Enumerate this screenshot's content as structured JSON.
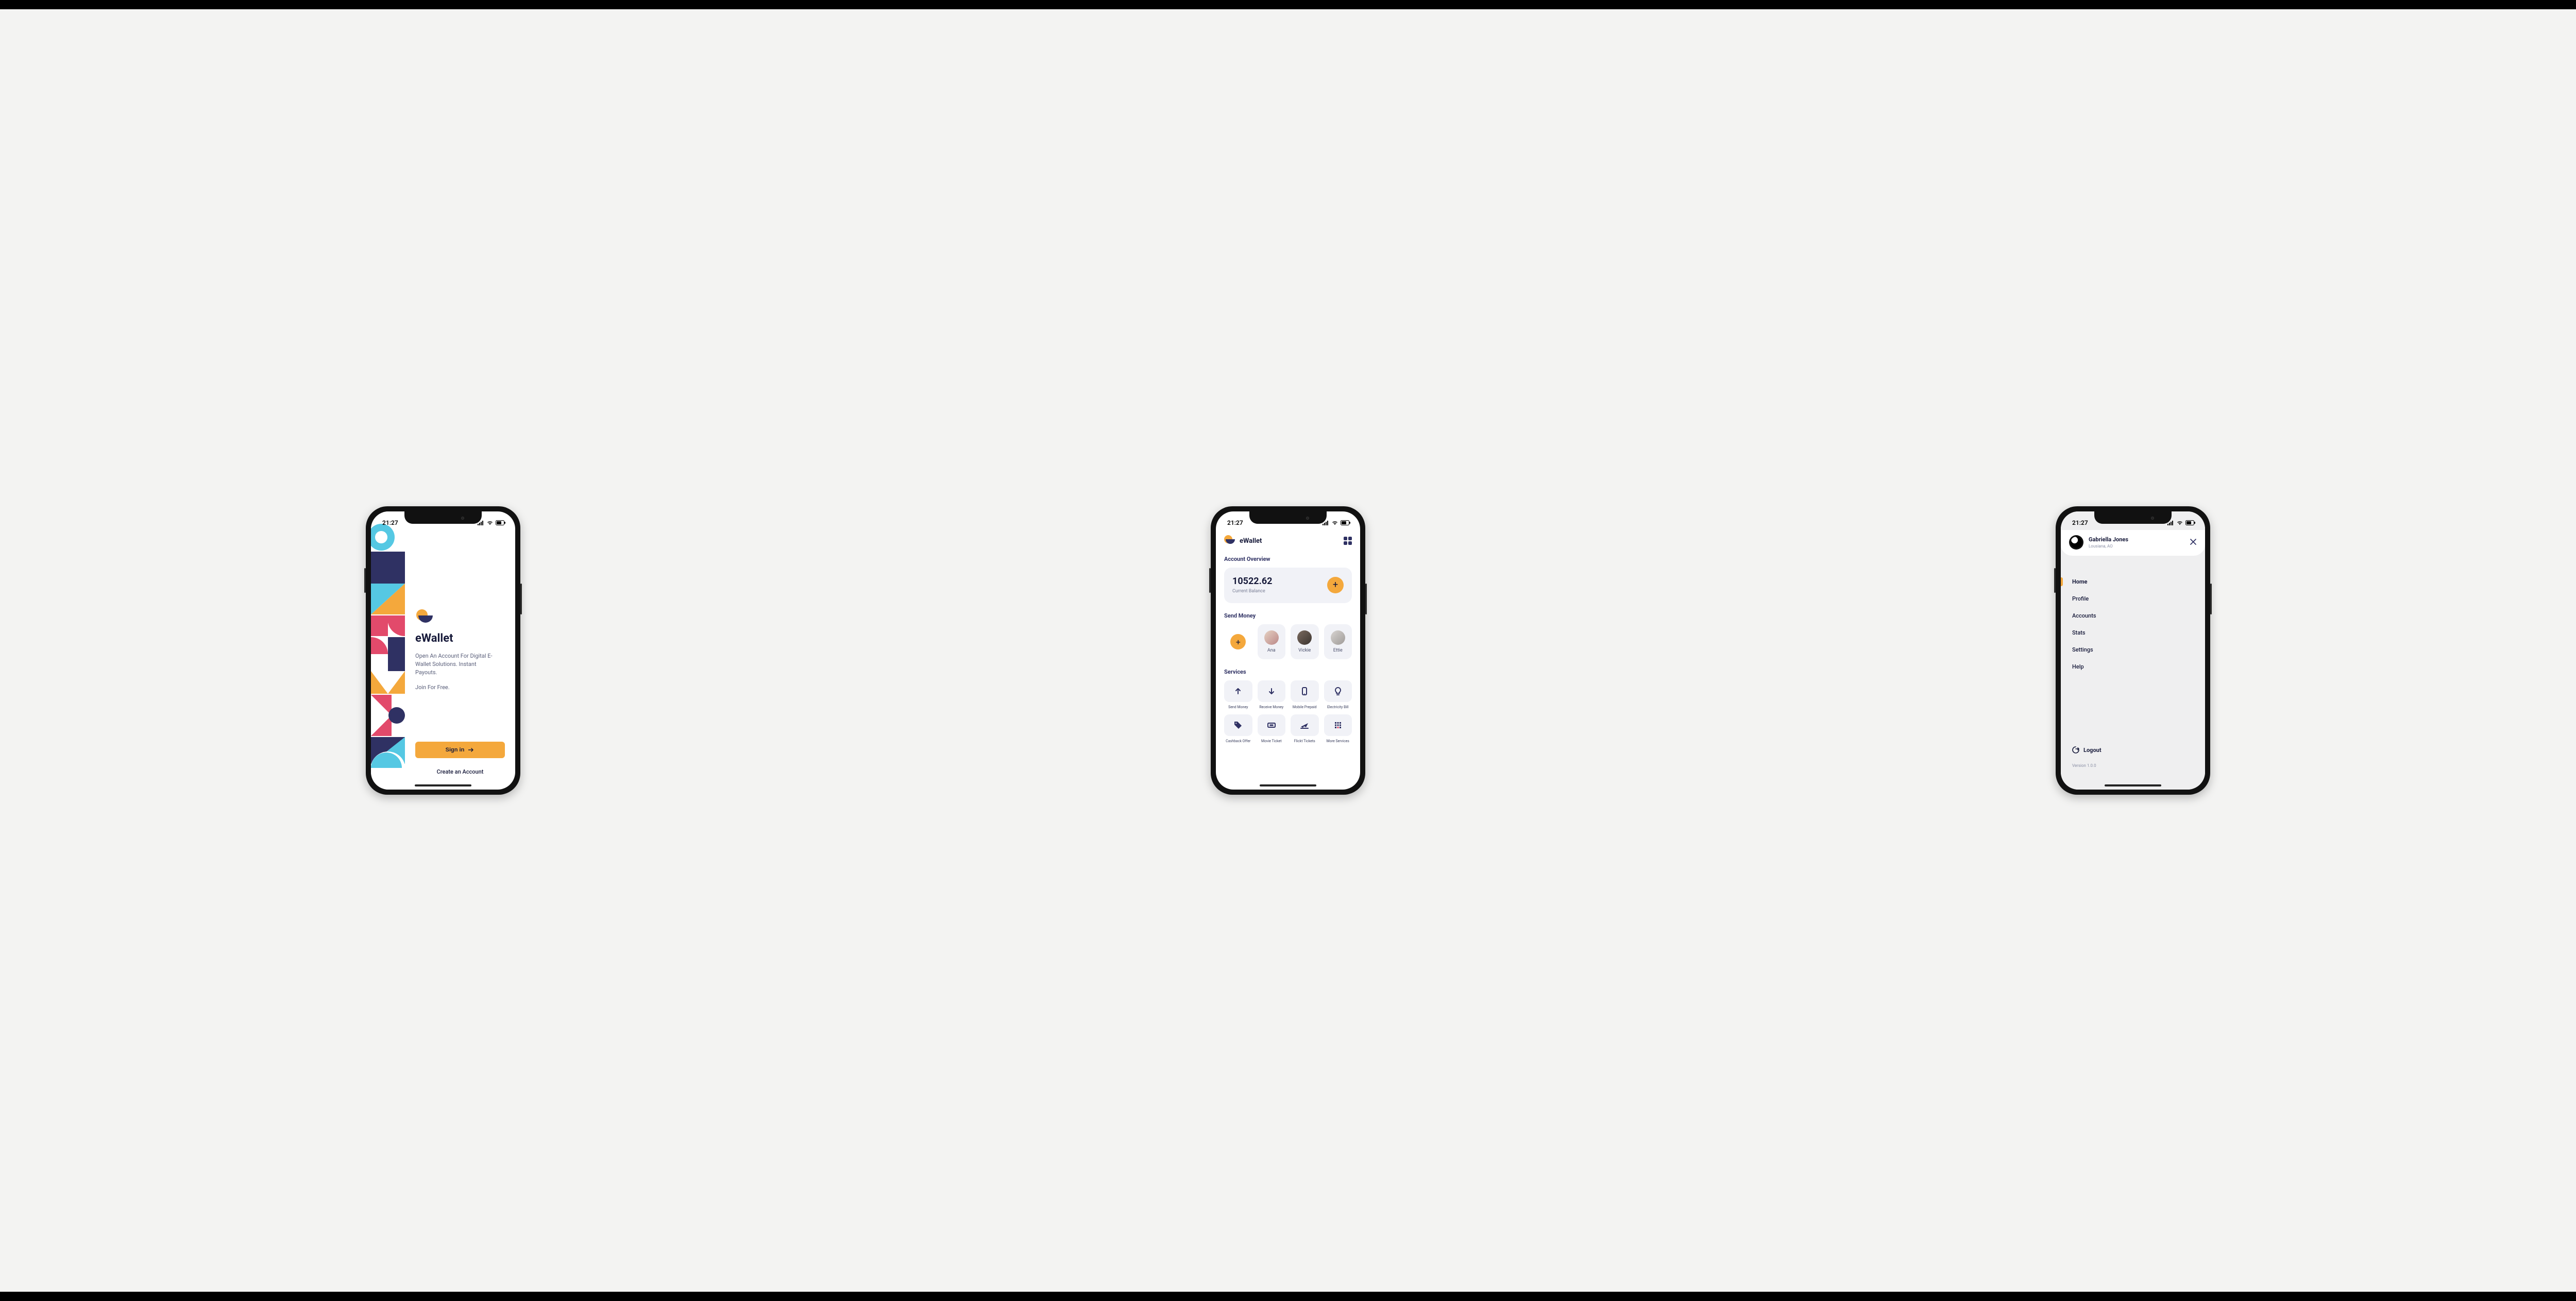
{
  "status": {
    "time": "21:27"
  },
  "s1": {
    "title": "eWallet",
    "desc": "Open An Account For Digital E-Wallet Solutions. Instant Payouts.",
    "join": "Join For Free.",
    "signin": "Sign in",
    "create": "Create an Account"
  },
  "s2": {
    "brand": "eWallet",
    "overview_title": "Account Overview",
    "balance": "10522.62",
    "balance_label": "Current Balance",
    "send_title": "Send Money",
    "contacts": [
      {
        "name": "Ana"
      },
      {
        "name": "Vickie"
      },
      {
        "name": "Ettie"
      }
    ],
    "services_title": "Services",
    "services": [
      {
        "label": "Send Money",
        "icon": "arrow-up"
      },
      {
        "label": "Receive Money",
        "icon": "arrow-down"
      },
      {
        "label": "Mobile Prepaid",
        "icon": "phone"
      },
      {
        "label": "Electricity Bill",
        "icon": "bulb"
      },
      {
        "label": "Cashback Offer",
        "icon": "tag"
      },
      {
        "label": "Movie Ticket",
        "icon": "ticket"
      },
      {
        "label": "Flickt Tickets",
        "icon": "plane"
      },
      {
        "label": "More Services",
        "icon": "grid"
      }
    ]
  },
  "s3": {
    "name": "Gabriella Jones",
    "location": "Lousiana, AO",
    "menu": [
      {
        "label": "Home",
        "active": true
      },
      {
        "label": "Profile"
      },
      {
        "label": "Accounts"
      },
      {
        "label": "Stats"
      },
      {
        "label": "Settings"
      },
      {
        "label": "Help"
      }
    ],
    "logout": "Logout",
    "version": "Version 1.0.0"
  }
}
